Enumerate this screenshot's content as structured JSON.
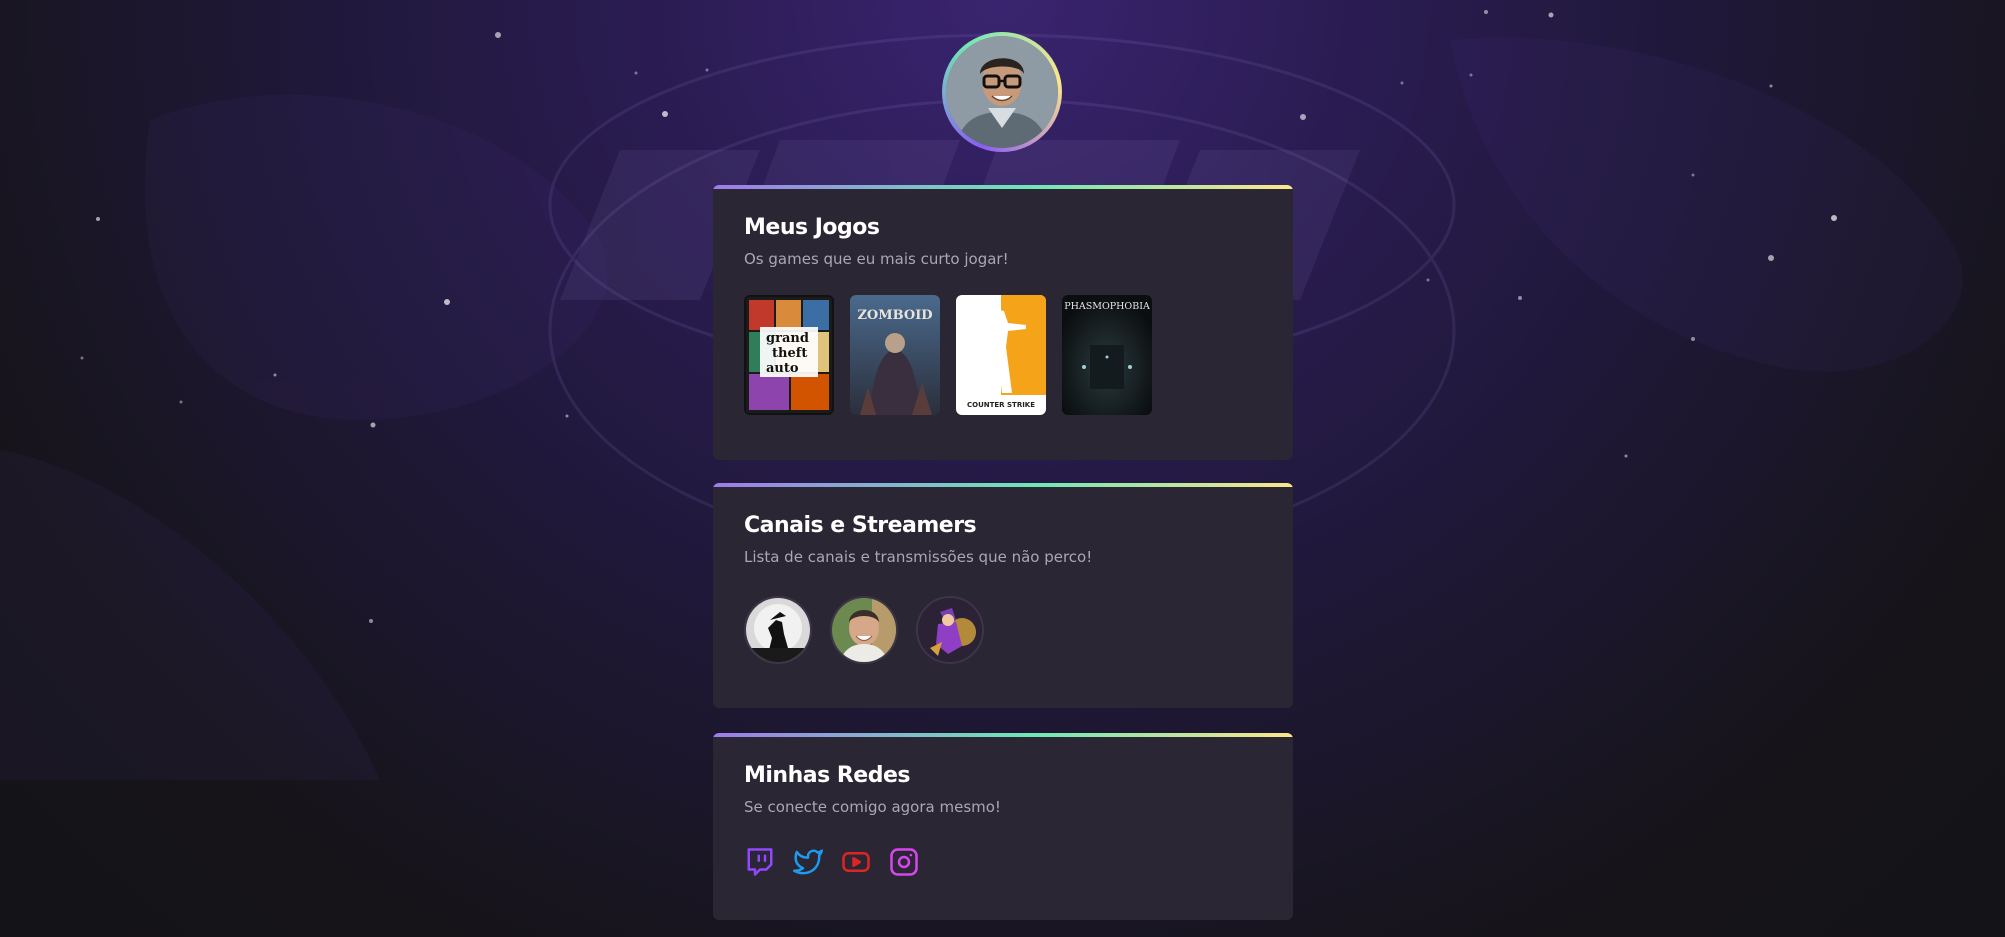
{
  "profile": {
    "avatar_alt": "profile photo"
  },
  "sections": {
    "games": {
      "title": "Meus Jogos",
      "subtitle": "Os games que eu mais curto jogar!",
      "items": [
        {
          "name": "Grand Theft Auto V",
          "icon": "gta-cover"
        },
        {
          "name": "Project Zomboid",
          "icon": "zomboid-cover"
        },
        {
          "name": "Counter-Strike",
          "icon": "counter-strike-cover"
        },
        {
          "name": "Phasmophobia",
          "icon": "phasmophobia-cover"
        }
      ],
      "cover_text": {
        "gta_line1": "grand",
        "gta_line2": "theft",
        "gta_line3": "auto",
        "zomboid": "ZOMBOID",
        "cs": "COUNTER STRIKE",
        "phasmo": "PHASMOPHOBIA"
      }
    },
    "channels": {
      "title": "Canais e Streamers",
      "subtitle": "Lista de canais e transmissões que não perco!",
      "items": [
        {
          "icon": "channel-avatar-silhouette"
        },
        {
          "icon": "channel-avatar-man"
        },
        {
          "icon": "channel-avatar-cartoon"
        }
      ]
    },
    "socials": {
      "title": "Minhas Redes",
      "subtitle": "Se conecte comigo agora mesmo!",
      "items": [
        {
          "name": "Twitch",
          "icon": "twitch-icon",
          "color": "#9146ff"
        },
        {
          "name": "Twitter",
          "icon": "twitter-icon",
          "color": "#1d9bf0"
        },
        {
          "name": "YouTube",
          "icon": "youtube-icon",
          "color": "#e02424"
        },
        {
          "name": "Instagram",
          "icon": "instagram-icon",
          "color": "#d946ef"
        }
      ]
    }
  },
  "colors": {
    "card_bg": "#2a2634",
    "accent_start": "#9f7aea",
    "accent_mid": "#6ee7b7",
    "accent_end": "#fde68a",
    "subtitle": "#a8a8b3"
  }
}
